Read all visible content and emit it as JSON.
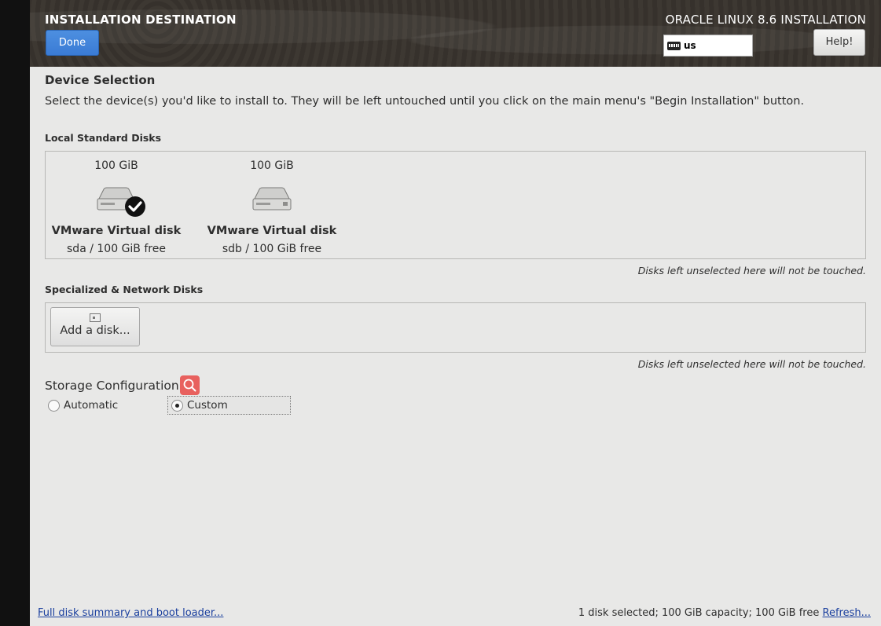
{
  "header": {
    "title": "INSTALLATION DESTINATION",
    "done_label": "Done",
    "product": "ORACLE LINUX 8.6 INSTALLATION",
    "keyboard_layout": "us",
    "help_label": "Help!"
  },
  "device_selection": {
    "title": "Device Selection",
    "description": "Select the device(s) you'd like to install to.  They will be left untouched until you click on the main menu's \"Begin Installation\" button."
  },
  "local_disks": {
    "heading": "Local Standard Disks",
    "disks": [
      {
        "size": "100 GiB",
        "name": "VMware Virtual disk",
        "device": "sda  /  100 GiB free",
        "selected": true
      },
      {
        "size": "100 GiB",
        "name": "VMware Virtual disk",
        "device": "sdb  /  100 GiB free",
        "selected": false
      }
    ],
    "note": "Disks left unselected here will not be touched."
  },
  "network_disks": {
    "heading": "Specialized & Network Disks",
    "add_label": "Add a disk...",
    "note": "Disks left unselected here will not be touched."
  },
  "storage_config": {
    "title": "Storage Configuration",
    "options": [
      {
        "label": "Automatic",
        "selected": false
      },
      {
        "label": "Custom",
        "selected": true
      }
    ]
  },
  "footer": {
    "summary_link": "Full disk summary and boot loader...",
    "status": "1 disk selected; 100 GiB capacity; 100 GiB free",
    "refresh_label": "Refresh..."
  },
  "colors": {
    "done_blue": "#3a7bd5",
    "link_blue": "#1a3f9e",
    "badge_red": "#e8615e"
  }
}
